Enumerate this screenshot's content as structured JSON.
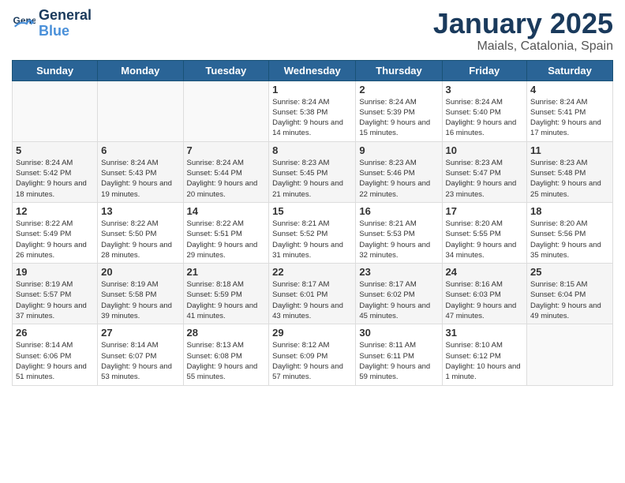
{
  "header": {
    "logo_line1": "General",
    "logo_line2": "Blue",
    "month": "January 2025",
    "location": "Maials, Catalonia, Spain"
  },
  "weekdays": [
    "Sunday",
    "Monday",
    "Tuesday",
    "Wednesday",
    "Thursday",
    "Friday",
    "Saturday"
  ],
  "weeks": [
    [
      {
        "day": "",
        "sunrise": "",
        "sunset": "",
        "daylight": ""
      },
      {
        "day": "",
        "sunrise": "",
        "sunset": "",
        "daylight": ""
      },
      {
        "day": "",
        "sunrise": "",
        "sunset": "",
        "daylight": ""
      },
      {
        "day": "1",
        "sunrise": "Sunrise: 8:24 AM",
        "sunset": "Sunset: 5:38 PM",
        "daylight": "Daylight: 9 hours and 14 minutes."
      },
      {
        "day": "2",
        "sunrise": "Sunrise: 8:24 AM",
        "sunset": "Sunset: 5:39 PM",
        "daylight": "Daylight: 9 hours and 15 minutes."
      },
      {
        "day": "3",
        "sunrise": "Sunrise: 8:24 AM",
        "sunset": "Sunset: 5:40 PM",
        "daylight": "Daylight: 9 hours and 16 minutes."
      },
      {
        "day": "4",
        "sunrise": "Sunrise: 8:24 AM",
        "sunset": "Sunset: 5:41 PM",
        "daylight": "Daylight: 9 hours and 17 minutes."
      }
    ],
    [
      {
        "day": "5",
        "sunrise": "Sunrise: 8:24 AM",
        "sunset": "Sunset: 5:42 PM",
        "daylight": "Daylight: 9 hours and 18 minutes."
      },
      {
        "day": "6",
        "sunrise": "Sunrise: 8:24 AM",
        "sunset": "Sunset: 5:43 PM",
        "daylight": "Daylight: 9 hours and 19 minutes."
      },
      {
        "day": "7",
        "sunrise": "Sunrise: 8:24 AM",
        "sunset": "Sunset: 5:44 PM",
        "daylight": "Daylight: 9 hours and 20 minutes."
      },
      {
        "day": "8",
        "sunrise": "Sunrise: 8:23 AM",
        "sunset": "Sunset: 5:45 PM",
        "daylight": "Daylight: 9 hours and 21 minutes."
      },
      {
        "day": "9",
        "sunrise": "Sunrise: 8:23 AM",
        "sunset": "Sunset: 5:46 PM",
        "daylight": "Daylight: 9 hours and 22 minutes."
      },
      {
        "day": "10",
        "sunrise": "Sunrise: 8:23 AM",
        "sunset": "Sunset: 5:47 PM",
        "daylight": "Daylight: 9 hours and 23 minutes."
      },
      {
        "day": "11",
        "sunrise": "Sunrise: 8:23 AM",
        "sunset": "Sunset: 5:48 PM",
        "daylight": "Daylight: 9 hours and 25 minutes."
      }
    ],
    [
      {
        "day": "12",
        "sunrise": "Sunrise: 8:22 AM",
        "sunset": "Sunset: 5:49 PM",
        "daylight": "Daylight: 9 hours and 26 minutes."
      },
      {
        "day": "13",
        "sunrise": "Sunrise: 8:22 AM",
        "sunset": "Sunset: 5:50 PM",
        "daylight": "Daylight: 9 hours and 28 minutes."
      },
      {
        "day": "14",
        "sunrise": "Sunrise: 8:22 AM",
        "sunset": "Sunset: 5:51 PM",
        "daylight": "Daylight: 9 hours and 29 minutes."
      },
      {
        "day": "15",
        "sunrise": "Sunrise: 8:21 AM",
        "sunset": "Sunset: 5:52 PM",
        "daylight": "Daylight: 9 hours and 31 minutes."
      },
      {
        "day": "16",
        "sunrise": "Sunrise: 8:21 AM",
        "sunset": "Sunset: 5:53 PM",
        "daylight": "Daylight: 9 hours and 32 minutes."
      },
      {
        "day": "17",
        "sunrise": "Sunrise: 8:20 AM",
        "sunset": "Sunset: 5:55 PM",
        "daylight": "Daylight: 9 hours and 34 minutes."
      },
      {
        "day": "18",
        "sunrise": "Sunrise: 8:20 AM",
        "sunset": "Sunset: 5:56 PM",
        "daylight": "Daylight: 9 hours and 35 minutes."
      }
    ],
    [
      {
        "day": "19",
        "sunrise": "Sunrise: 8:19 AM",
        "sunset": "Sunset: 5:57 PM",
        "daylight": "Daylight: 9 hours and 37 minutes."
      },
      {
        "day": "20",
        "sunrise": "Sunrise: 8:19 AM",
        "sunset": "Sunset: 5:58 PM",
        "daylight": "Daylight: 9 hours and 39 minutes."
      },
      {
        "day": "21",
        "sunrise": "Sunrise: 8:18 AM",
        "sunset": "Sunset: 5:59 PM",
        "daylight": "Daylight: 9 hours and 41 minutes."
      },
      {
        "day": "22",
        "sunrise": "Sunrise: 8:17 AM",
        "sunset": "Sunset: 6:01 PM",
        "daylight": "Daylight: 9 hours and 43 minutes."
      },
      {
        "day": "23",
        "sunrise": "Sunrise: 8:17 AM",
        "sunset": "Sunset: 6:02 PM",
        "daylight": "Daylight: 9 hours and 45 minutes."
      },
      {
        "day": "24",
        "sunrise": "Sunrise: 8:16 AM",
        "sunset": "Sunset: 6:03 PM",
        "daylight": "Daylight: 9 hours and 47 minutes."
      },
      {
        "day": "25",
        "sunrise": "Sunrise: 8:15 AM",
        "sunset": "Sunset: 6:04 PM",
        "daylight": "Daylight: 9 hours and 49 minutes."
      }
    ],
    [
      {
        "day": "26",
        "sunrise": "Sunrise: 8:14 AM",
        "sunset": "Sunset: 6:06 PM",
        "daylight": "Daylight: 9 hours and 51 minutes."
      },
      {
        "day": "27",
        "sunrise": "Sunrise: 8:14 AM",
        "sunset": "Sunset: 6:07 PM",
        "daylight": "Daylight: 9 hours and 53 minutes."
      },
      {
        "day": "28",
        "sunrise": "Sunrise: 8:13 AM",
        "sunset": "Sunset: 6:08 PM",
        "daylight": "Daylight: 9 hours and 55 minutes."
      },
      {
        "day": "29",
        "sunrise": "Sunrise: 8:12 AM",
        "sunset": "Sunset: 6:09 PM",
        "daylight": "Daylight: 9 hours and 57 minutes."
      },
      {
        "day": "30",
        "sunrise": "Sunrise: 8:11 AM",
        "sunset": "Sunset: 6:11 PM",
        "daylight": "Daylight: 9 hours and 59 minutes."
      },
      {
        "day": "31",
        "sunrise": "Sunrise: 8:10 AM",
        "sunset": "Sunset: 6:12 PM",
        "daylight": "Daylight: 10 hours and 1 minute."
      },
      {
        "day": "",
        "sunrise": "",
        "sunset": "",
        "daylight": ""
      }
    ]
  ]
}
